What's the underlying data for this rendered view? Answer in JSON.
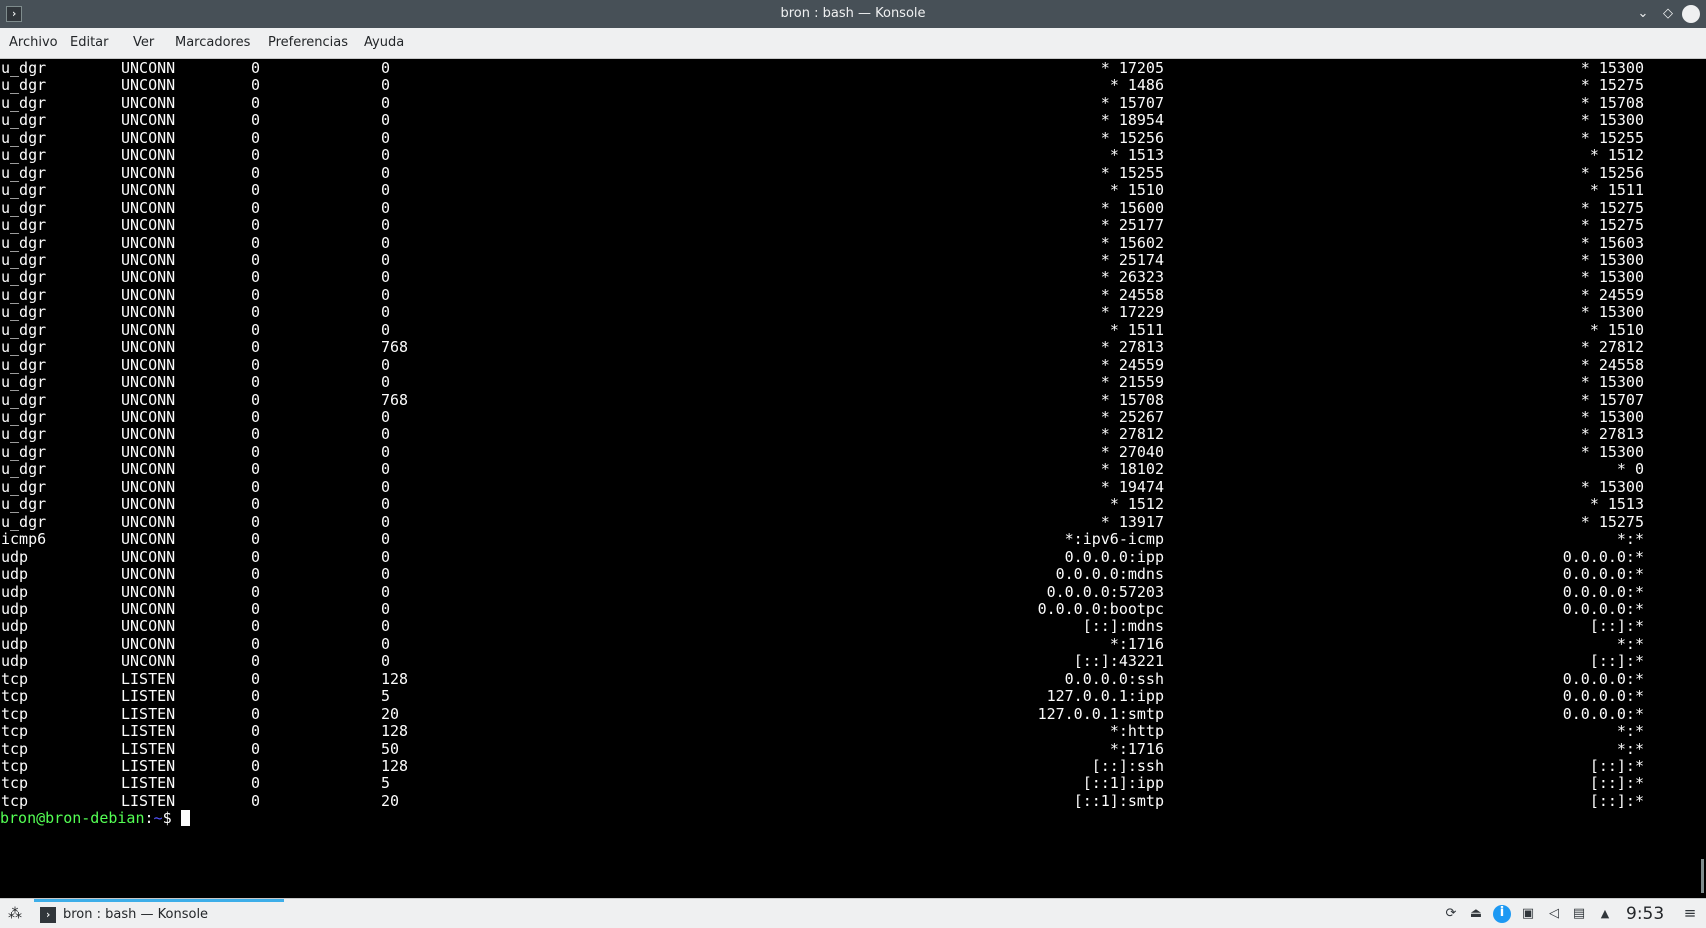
{
  "window": {
    "title": "bron : bash — Konsole",
    "icons": {
      "app": "konsole-icon",
      "minimize": "chevron-down-icon",
      "maximize": "diamond-icon",
      "close": "close-icon"
    }
  },
  "menubar": {
    "items": [
      "Archivo",
      "Editar",
      "Ver",
      "Marcadores",
      "Preferencias",
      "Ayuda"
    ]
  },
  "terminal": {
    "rows": [
      [
        "u_dgr",
        "UNCONN",
        "0",
        "0",
        "* 17205",
        "* 15300"
      ],
      [
        "u_dgr",
        "UNCONN",
        "0",
        "0",
        "* 1486",
        "* 15275"
      ],
      [
        "u_dgr",
        "UNCONN",
        "0",
        "0",
        "* 15707",
        "* 15708"
      ],
      [
        "u_dgr",
        "UNCONN",
        "0",
        "0",
        "* 18954",
        "* 15300"
      ],
      [
        "u_dgr",
        "UNCONN",
        "0",
        "0",
        "* 15256",
        "* 15255"
      ],
      [
        "u_dgr",
        "UNCONN",
        "0",
        "0",
        "* 1513",
        "* 1512"
      ],
      [
        "u_dgr",
        "UNCONN",
        "0",
        "0",
        "* 15255",
        "* 15256"
      ],
      [
        "u_dgr",
        "UNCONN",
        "0",
        "0",
        "* 1510",
        "* 1511"
      ],
      [
        "u_dgr",
        "UNCONN",
        "0",
        "0",
        "* 15600",
        "* 15275"
      ],
      [
        "u_dgr",
        "UNCONN",
        "0",
        "0",
        "* 25177",
        "* 15275"
      ],
      [
        "u_dgr",
        "UNCONN",
        "0",
        "0",
        "* 15602",
        "* 15603"
      ],
      [
        "u_dgr",
        "UNCONN",
        "0",
        "0",
        "* 25174",
        "* 15300"
      ],
      [
        "u_dgr",
        "UNCONN",
        "0",
        "0",
        "* 26323",
        "* 15300"
      ],
      [
        "u_dgr",
        "UNCONN",
        "0",
        "0",
        "* 24558",
        "* 24559"
      ],
      [
        "u_dgr",
        "UNCONN",
        "0",
        "0",
        "* 17229",
        "* 15300"
      ],
      [
        "u_dgr",
        "UNCONN",
        "0",
        "0",
        "* 1511",
        "* 1510"
      ],
      [
        "u_dgr",
        "UNCONN",
        "0",
        "768",
        "* 27813",
        "* 27812"
      ],
      [
        "u_dgr",
        "UNCONN",
        "0",
        "0",
        "* 24559",
        "* 24558"
      ],
      [
        "u_dgr",
        "UNCONN",
        "0",
        "0",
        "* 21559",
        "* 15300"
      ],
      [
        "u_dgr",
        "UNCONN",
        "0",
        "768",
        "* 15708",
        "* 15707"
      ],
      [
        "u_dgr",
        "UNCONN",
        "0",
        "0",
        "* 25267",
        "* 15300"
      ],
      [
        "u_dgr",
        "UNCONN",
        "0",
        "0",
        "* 27812",
        "* 27813"
      ],
      [
        "u_dgr",
        "UNCONN",
        "0",
        "0",
        "* 27040",
        "* 15300"
      ],
      [
        "u_dgr",
        "UNCONN",
        "0",
        "0",
        "* 18102",
        "* 0"
      ],
      [
        "u_dgr",
        "UNCONN",
        "0",
        "0",
        "* 19474",
        "* 15300"
      ],
      [
        "u_dgr",
        "UNCONN",
        "0",
        "0",
        "* 1512",
        "* 1513"
      ],
      [
        "u_dgr",
        "UNCONN",
        "0",
        "0",
        "* 13917",
        "* 15275"
      ],
      [
        "icmp6",
        "UNCONN",
        "0",
        "0",
        "*:ipv6-icmp",
        "*:*"
      ],
      [
        "udp",
        "UNCONN",
        "0",
        "0",
        "0.0.0.0:ipp",
        "0.0.0.0:*"
      ],
      [
        "udp",
        "UNCONN",
        "0",
        "0",
        "0.0.0.0:mdns",
        "0.0.0.0:*"
      ],
      [
        "udp",
        "UNCONN",
        "0",
        "0",
        "0.0.0.0:57203",
        "0.0.0.0:*"
      ],
      [
        "udp",
        "UNCONN",
        "0",
        "0",
        "0.0.0.0:bootpc",
        "0.0.0.0:*"
      ],
      [
        "udp",
        "UNCONN",
        "0",
        "0",
        "[::]:mdns",
        "[::]:*"
      ],
      [
        "udp",
        "UNCONN",
        "0",
        "0",
        "*:1716",
        "*:*"
      ],
      [
        "udp",
        "UNCONN",
        "0",
        "0",
        "[::]:43221",
        "[::]:*"
      ],
      [
        "tcp",
        "LISTEN",
        "0",
        "128",
        "0.0.0.0:ssh",
        "0.0.0.0:*"
      ],
      [
        "tcp",
        "LISTEN",
        "0",
        "5",
        "127.0.0.1:ipp",
        "0.0.0.0:*"
      ],
      [
        "tcp",
        "LISTEN",
        "0",
        "20",
        "127.0.0.1:smtp",
        "0.0.0.0:*"
      ],
      [
        "tcp",
        "LISTEN",
        "0",
        "128",
        "*:http",
        "*:*"
      ],
      [
        "tcp",
        "LISTEN",
        "0",
        "50",
        "*:1716",
        "*:*"
      ],
      [
        "tcp",
        "LISTEN",
        "0",
        "128",
        "[::]:ssh",
        "[::]:*"
      ],
      [
        "tcp",
        "LISTEN",
        "0",
        "5",
        "[::1]:ipp",
        "[::]:*"
      ],
      [
        "tcp",
        "LISTEN",
        "0",
        "20",
        "[::1]:smtp",
        "[::]:*"
      ]
    ],
    "prompt": {
      "user_host": "bron@bron-debian",
      "separator": ":",
      "path": "~",
      "symbol": "$ "
    }
  },
  "taskbar": {
    "task_label": "bron : bash — Konsole",
    "clock": "9:53",
    "tray_icons": [
      "update-icon",
      "usb-icon",
      "accessibility-icon",
      "network-icon",
      "volume-icon",
      "clipboard-icon",
      "expand-tray-icon"
    ]
  }
}
